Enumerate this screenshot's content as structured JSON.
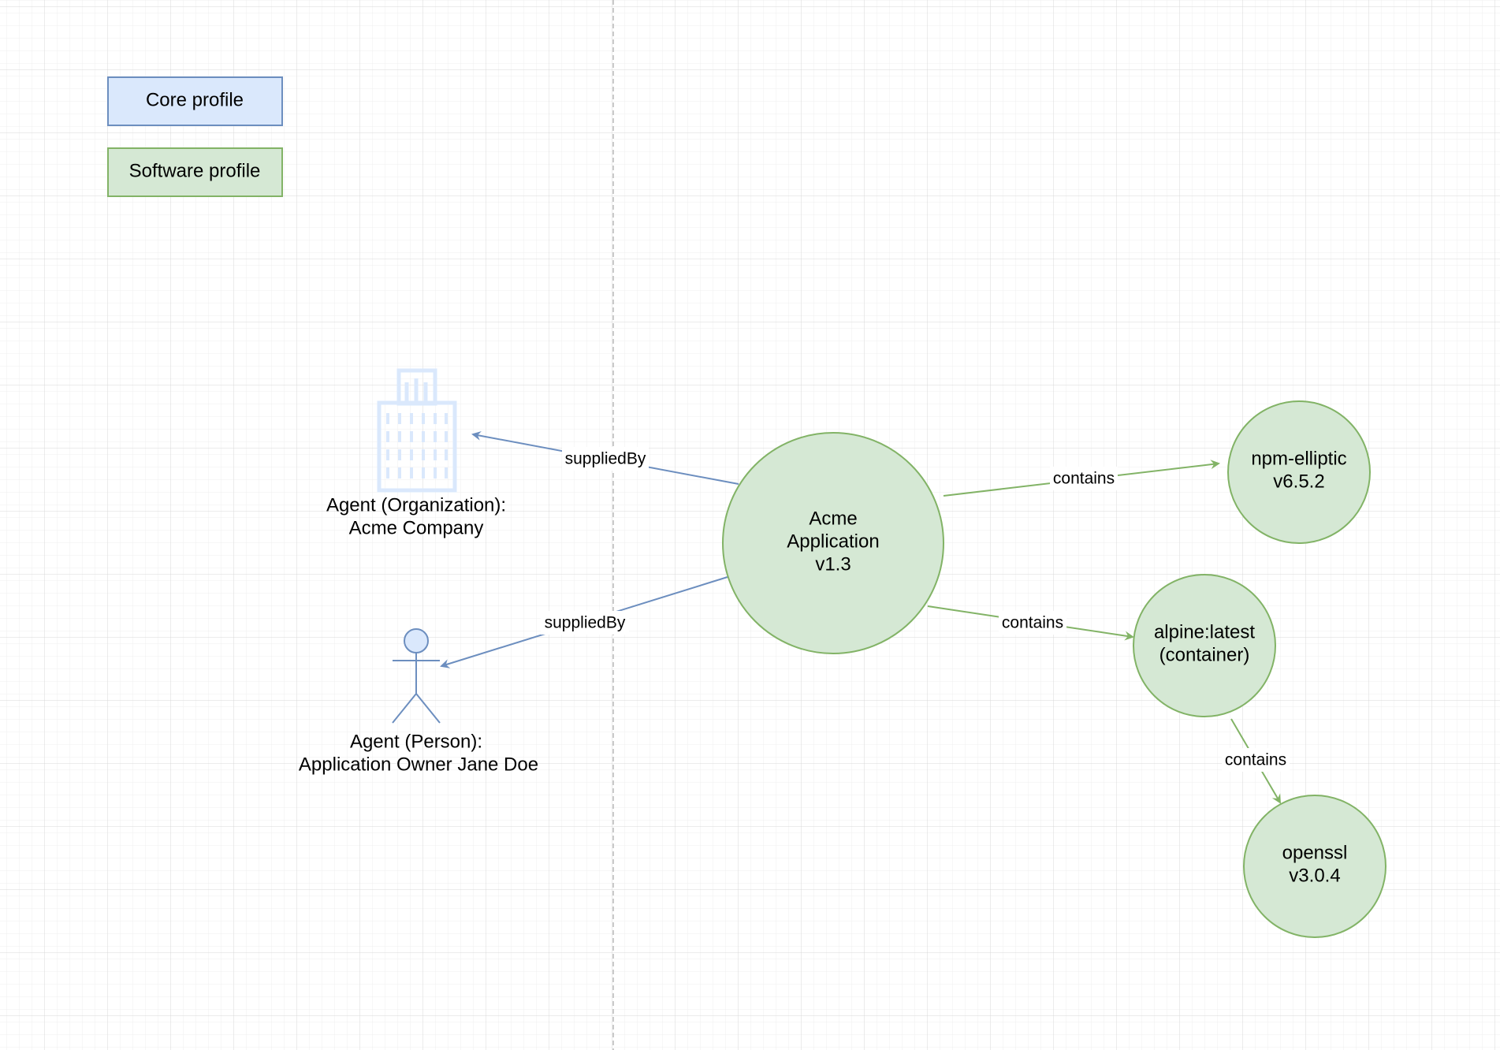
{
  "legend": {
    "core": {
      "label": "Core profile",
      "fill": "#dae8fc",
      "stroke": "#6c8ebf"
    },
    "software": {
      "label": "Software profile",
      "fill": "#d5e8d4",
      "stroke": "#82b366"
    }
  },
  "agents": {
    "organization": {
      "line1": "Agent (Organization):",
      "line2": "Acme Company",
      "icon": "building-icon"
    },
    "person": {
      "line1": "Agent (Person):",
      "line2": "Application Owner Jane Doe",
      "icon": "person-icon"
    }
  },
  "packages": {
    "acme": {
      "line1": "Acme",
      "line2": "Application",
      "line3": "v1.3"
    },
    "npm": {
      "line1": "npm-elliptic",
      "line2": "v6.5.2"
    },
    "alpine": {
      "line1": "alpine:latest",
      "line2": "(container)"
    },
    "openssl": {
      "line1": "openssl",
      "line2": "v3.0.4"
    }
  },
  "edges": {
    "supplied_org": "suppliedBy",
    "supplied_person": "suppliedBy",
    "contains_npm": "contains",
    "contains_alpine": "contains",
    "contains_openssl": "contains"
  },
  "colors": {
    "grid_minor": "#ececec",
    "grid_major": "#d6d6d6",
    "core_edge": "#6c8ebf",
    "software_edge": "#82b366",
    "divider": "#b8b8b8"
  }
}
